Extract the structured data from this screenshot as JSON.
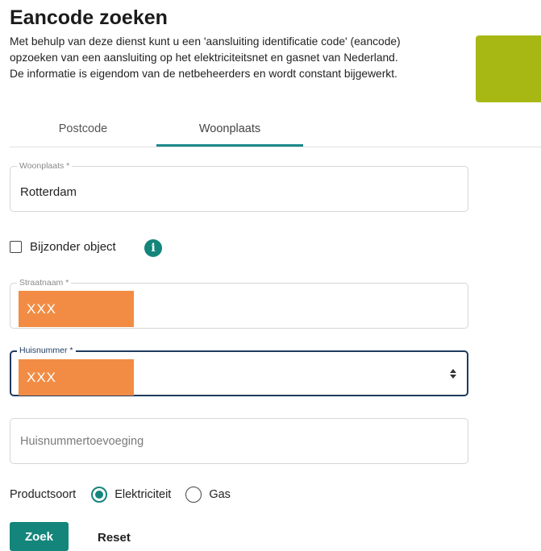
{
  "page": {
    "title": "Eancode zoeken",
    "description_lines": [
      "Met behulp van deze dienst kunt u een 'aansluiting identificatie code' (eancode)",
      "opzoeken van een aansluiting op het elektriciteitsnet en gasnet van Nederland.",
      "De informatie is eigendom van de netbeheerders en wordt constant bijgewerkt."
    ]
  },
  "tabs": [
    {
      "label": "Postcode",
      "active": false
    },
    {
      "label": "Woonplaats",
      "active": true
    }
  ],
  "form": {
    "woonplaats": {
      "label": "Woonplaats *",
      "value": "Rotterdam"
    },
    "bijzonder_object": {
      "label": "Bijzonder object",
      "checked": false
    },
    "straatnaam": {
      "label": "Straatnaam *",
      "value": "XXX"
    },
    "huisnummer": {
      "label": "Huisnummer *",
      "value": "XXX"
    },
    "huisnummertoevoeging": {
      "placeholder": "Huisnummertoevoeging"
    },
    "productsoort": {
      "label": "Productsoort",
      "options": [
        {
          "label": "Elektriciteit",
          "selected": true
        },
        {
          "label": "Gas",
          "selected": false
        }
      ]
    }
  },
  "buttons": {
    "search": "Zoek",
    "reset": "Reset"
  },
  "colors": {
    "accent": "#14857b",
    "brand_block": "#a7b814",
    "redaction": "#f28c44",
    "focus_border": "#1e3a5f"
  },
  "icons": {
    "info": "info-icon",
    "stepper": "stepper-arrows-icon"
  }
}
